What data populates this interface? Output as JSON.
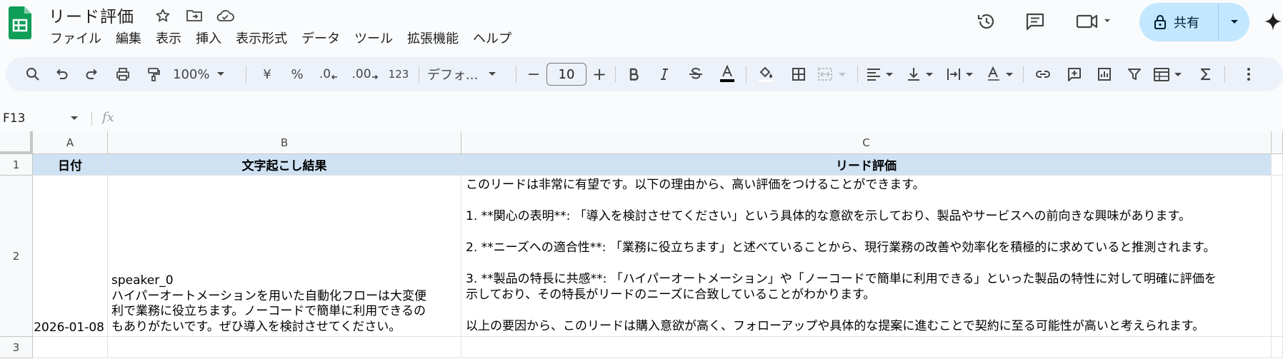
{
  "app": {
    "doc_title": "リード評価",
    "icons": [
      "sheets-logo",
      "star-icon",
      "move-to-folder-icon",
      "cloud-saved-icon"
    ],
    "menu": [
      "ファイル",
      "編集",
      "表示",
      "挿入",
      "表示形式",
      "データ",
      "ツール",
      "拡張機能",
      "ヘルプ"
    ],
    "right_icons": [
      "history-icon",
      "comment-icon",
      "meet-icon",
      "gemini-icon"
    ],
    "share_label": "共有",
    "accent_color": "#c2e7ff",
    "sheets_green": "#0f9d58"
  },
  "toolbar": {
    "zoom": "100%",
    "currency": "¥",
    "percent": "%",
    "decrease_decimal": ".0",
    "increase_decimal": ".00",
    "number_format": "123",
    "font": "デフォ...",
    "font_size": "10",
    "minus": "−",
    "plus": "+"
  },
  "formula_bar": {
    "name_box": "F13",
    "fx": "fx",
    "formula": ""
  },
  "grid": {
    "columns": [
      "A",
      "B",
      "C"
    ],
    "rows": [
      "1",
      "2",
      "3"
    ],
    "header_fill": "#cfe2f3",
    "header": {
      "a": "日付",
      "b": "文字起こし結果",
      "c": "リード評価"
    },
    "row2": {
      "a": "2026-01-08",
      "b_speaker": "speaker_0",
      "b_text": "ハイパーオートメーションを用いた自動化フローは大変便\n利で業務に役立ちます。ノーコードで簡単に利用できるの\nもありがたいです。ぜひ導入を検討させてください。",
      "c": "このリードは非常に有望です。以下の理由から、高い評価をつけることができます。\n\n1. **関心の表明**: 「導入を検討させてください」という具体的な意欲を示しており、製品やサービスへの前向きな興味があります。\n\n2. **ニーズへの適合性**: 「業務に役立ちます」と述べていることから、現行業務の改善や効率化を積極的に求めていると推測されます。\n\n3. **製品の特長に共感**: 「ハイパーオートメーション」や「ノーコードで簡単に利用できる」といった製品の特性に対して明確に評価を\n示しており、その特長がリードのニーズに合致していることがわかります。\n\n以上の要因から、このリードは購入意欲が高く、フォローアップや具体的な提案に進むことで契約に至る可能性が高いと考えられます。"
    }
  }
}
